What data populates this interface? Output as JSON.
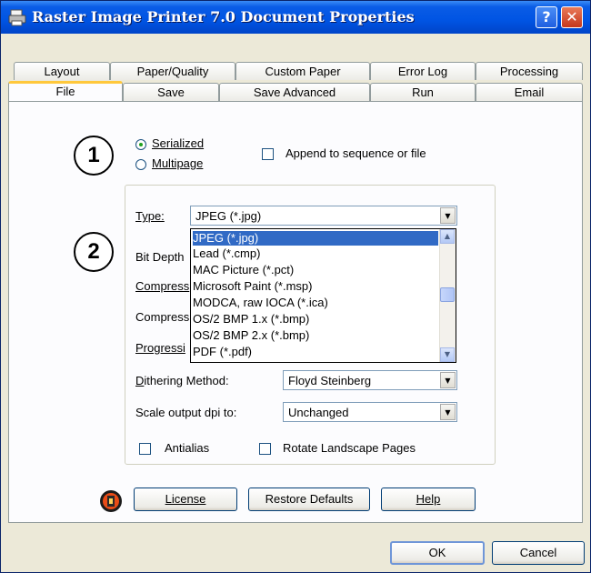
{
  "window": {
    "title": "Raster Image Printer 7.0 Document Properties",
    "help_glyph": "?",
    "close_glyph": "✕"
  },
  "tabs": {
    "row1": [
      "Layout",
      "Paper/Quality",
      "Custom Paper",
      "Error Log",
      "Processing"
    ],
    "row2": [
      "File",
      "Save",
      "Save Advanced",
      "Run",
      "Email"
    ],
    "active": "File"
  },
  "markers": {
    "one": "1",
    "two": "2"
  },
  "output_mode": {
    "serialized_label": "Serialized",
    "multipage_label": "Multipage",
    "selected": "Serialized",
    "append_label": "Append to sequence or file",
    "append_checked": false
  },
  "type": {
    "label": "Type:",
    "value": "JPEG (*.jpg)"
  },
  "type_dropdown": {
    "items": [
      "JPEG (*.jpg)",
      "Lead (*.cmp)",
      "MAC Picture (*.pct)",
      "Microsoft Paint (*.msp)",
      "MODCA, raw IOCA (*.ica)",
      "OS/2 BMP 1.x (*.bmp)",
      "OS/2 BMP 2.x (*.bmp)",
      "PDF (*.pdf)"
    ],
    "selected_index": 0
  },
  "hidden_labels": {
    "bit_depth": "Bit Depth",
    "compression": "Compress",
    "compression2": "Compress",
    "progressive": "Progressi"
  },
  "dithering": {
    "label": "Dithering Method:",
    "value": "Floyd Steinberg"
  },
  "scale": {
    "label": "Scale output dpi to:",
    "value": "Unchanged"
  },
  "options": {
    "antialias_label": "Antialias",
    "antialias_checked": false,
    "rotate_label": "Rotate Landscape Pages",
    "rotate_checked": false
  },
  "buttons": {
    "license": "License",
    "restore": "Restore Defaults",
    "help": "Help",
    "ok": "OK",
    "cancel": "Cancel"
  },
  "icons": {
    "title": "printer-icon",
    "license": "license-icon"
  }
}
